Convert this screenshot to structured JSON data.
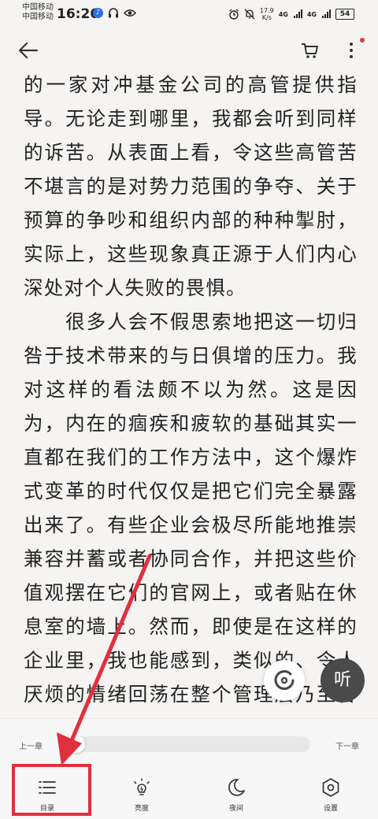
{
  "status_bar": {
    "carrier_1": "中国移动",
    "carrier_2": "中国移动",
    "time": "16:26",
    "network_speed_value": "17.9",
    "network_speed_unit": "K/s",
    "signal_1": "4G",
    "signal_2": "4G",
    "battery": "54"
  },
  "content": {
    "paragraphs": [
      "的一家对冲基金公司的高管提供指导。无论走到哪里，我都会听到同样的诉苦。从表面上看，令这些高管苦不堪言的是对势力范围的争夺、关于预算的争吵和组织内部的种种掣肘，实际上，这些现象真正源于人们内心深处对个人失败的畏惧。",
      "　　很多人会不假思索地把这一切归咎于技术带来的与日俱增的压力。我对这样的看法颇不以为然。这是因为，内在的痼疾和疲软的基础其实一直都在我们的工作方法中，这个爆炸式变革的时代仅仅是把它们完全暴露出来了。有些企业会极尽所能地推崇兼容并蓄或者协同合作，并把这些价值观摆在它们的官网上，或者贴在休息室的墙上。然而，即使是在这样的企业里，我也能感到，类似的、令人厌烦的情绪回荡在整个管理层乃至各个层面上。无论是高层管理人员、中"
    ]
  },
  "fab": {
    "listen_label": "听"
  },
  "bottom": {
    "prev_chapter": "上一章",
    "next_chapter": "下一章",
    "progress": 0.0,
    "menu": [
      {
        "label": "目录",
        "icon": "list-icon"
      },
      {
        "label": "亮度",
        "icon": "brightness-icon"
      },
      {
        "label": "夜间",
        "icon": "moon-icon"
      },
      {
        "label": "设置",
        "icon": "settings-icon"
      }
    ]
  },
  "colors": {
    "background": "#f5f4f2",
    "text": "#222222",
    "annotation_red": "#e0303f",
    "listen_button": "#4a4a4a",
    "notification_dot": "#e03a3a"
  }
}
